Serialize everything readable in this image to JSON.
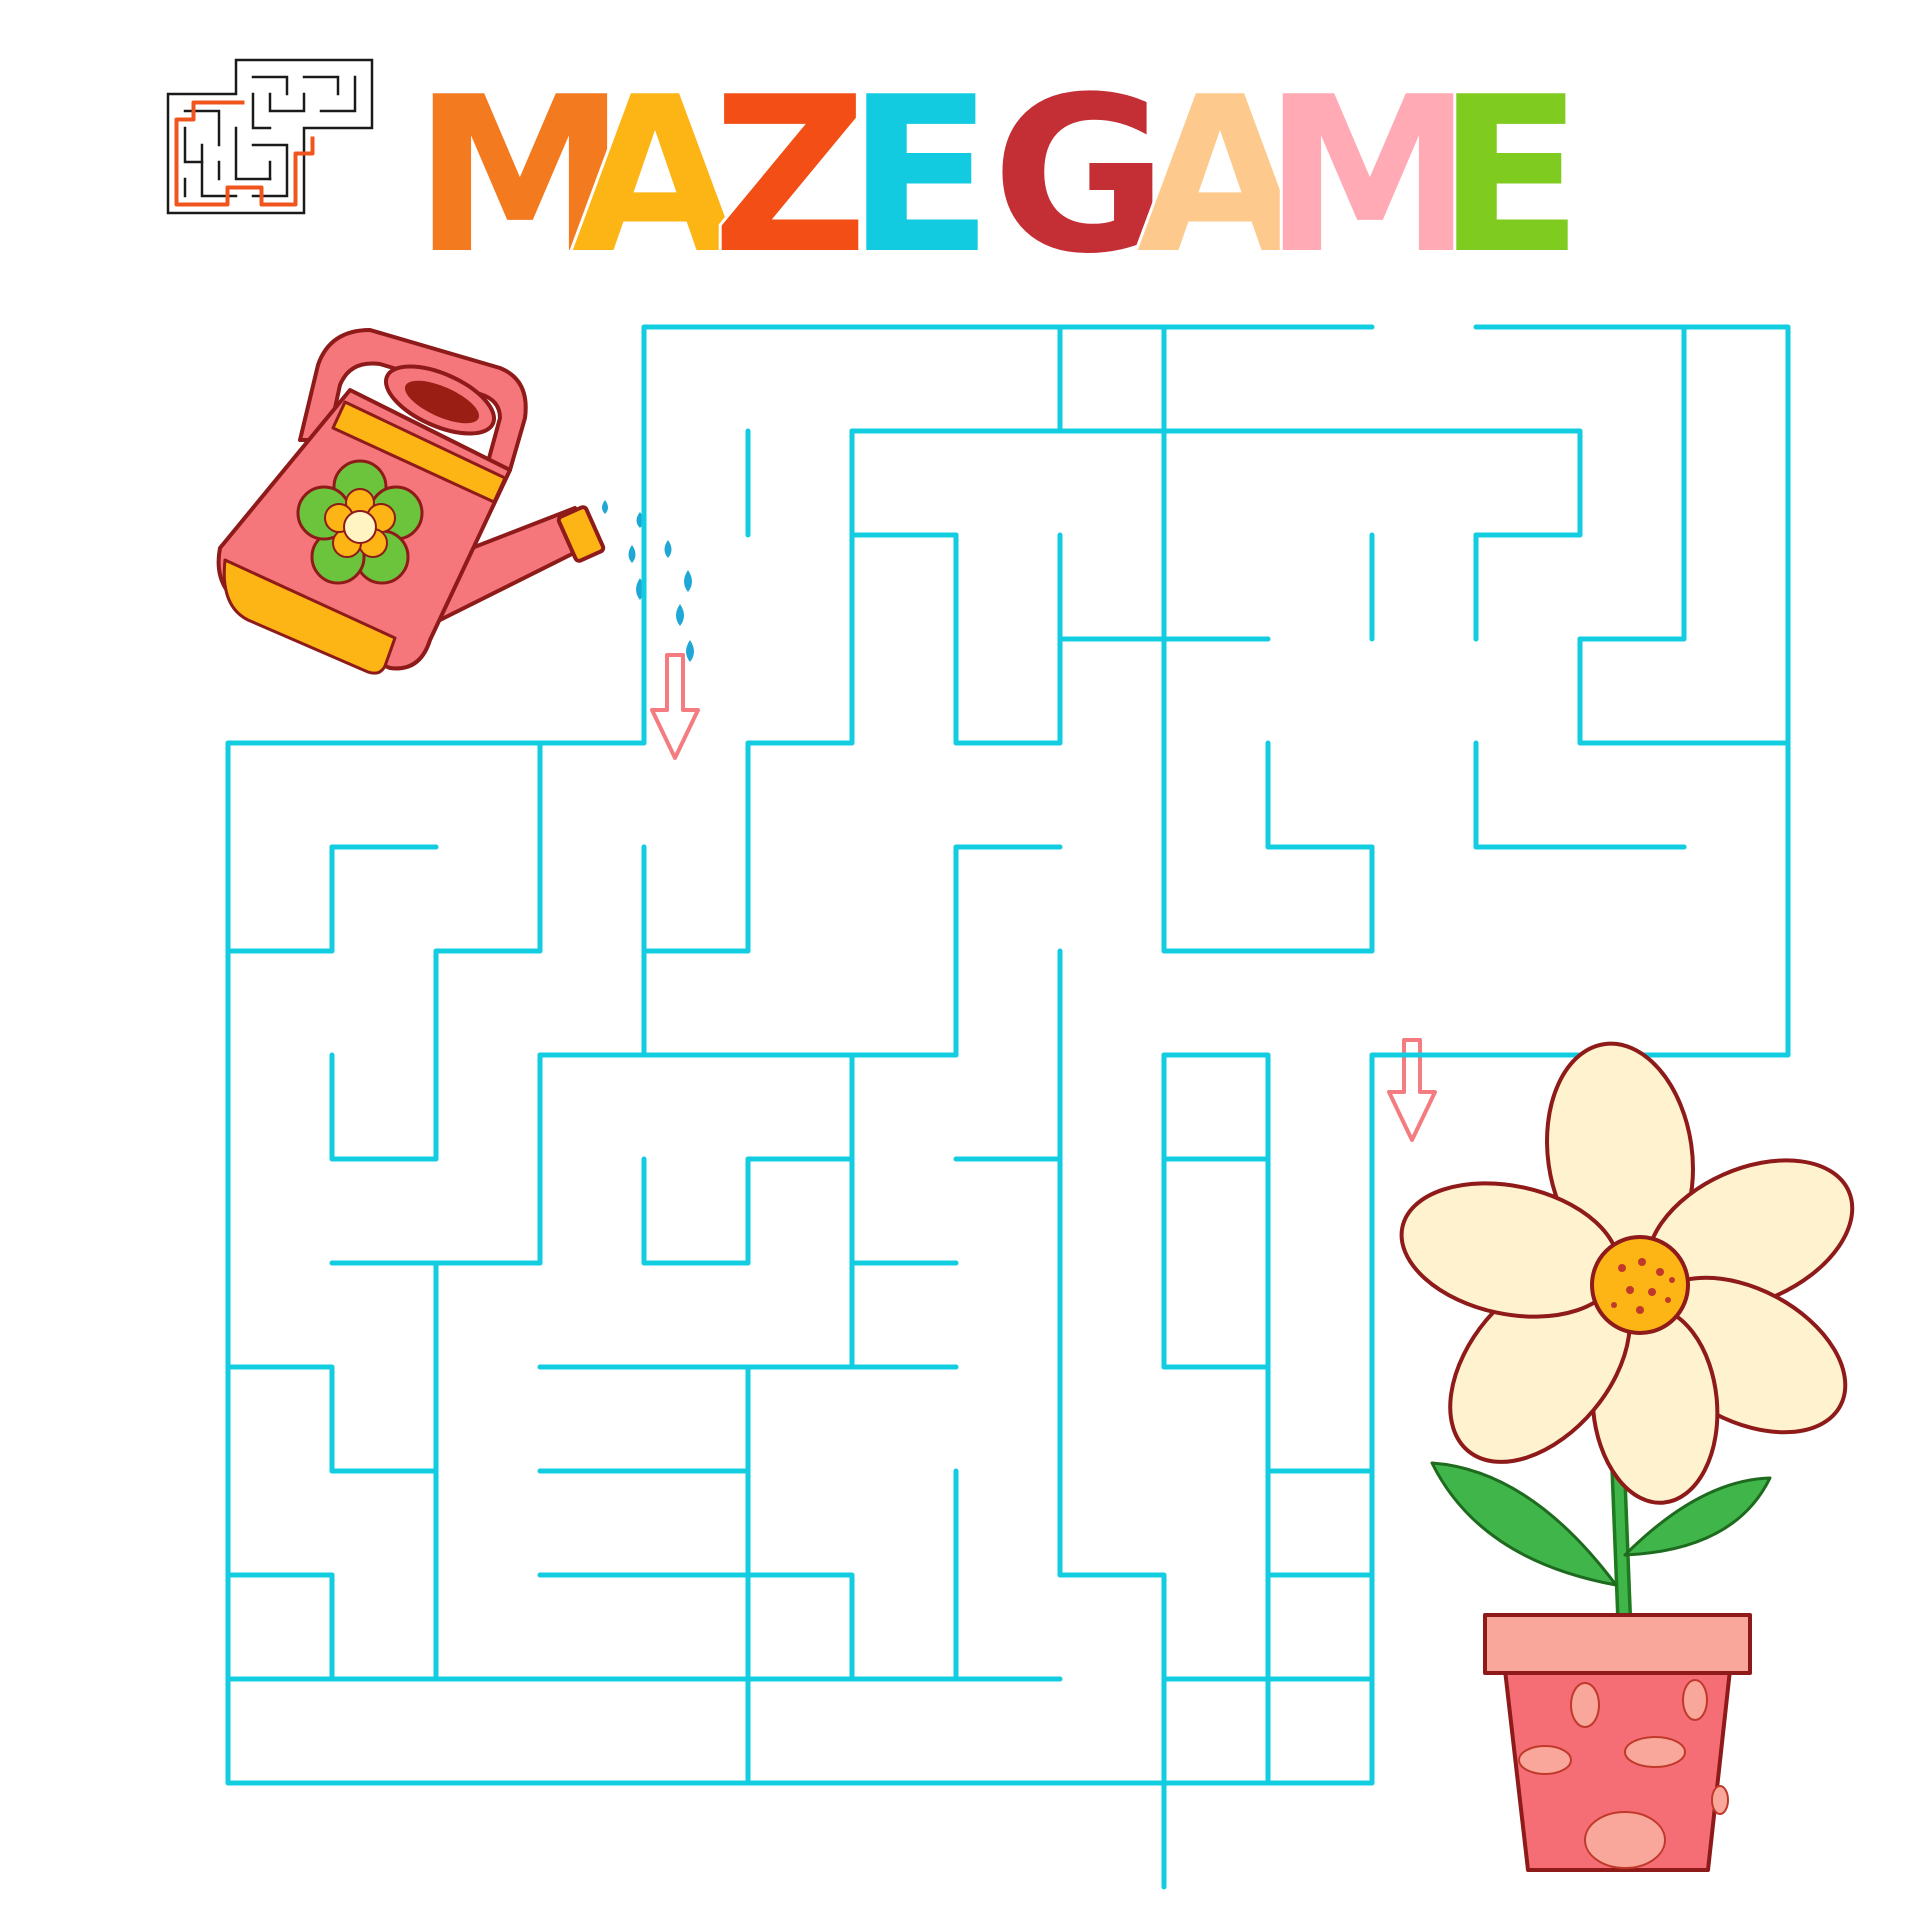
{
  "title": {
    "letters": [
      {
        "char": "M",
        "color": "#F47A20"
      },
      {
        "char": "A",
        "color": "#FDB515"
      },
      {
        "char": "Z",
        "color": "#F24E16"
      },
      {
        "char": "E",
        "color": "#12CBE0"
      },
      {
        "char": "G",
        "color": "#C42F36"
      },
      {
        "char": "A",
        "color": "#FDC98C"
      },
      {
        "char": "M",
        "color": "#FFAAB5"
      },
      {
        "char": "E",
        "color": "#7FCB1F"
      }
    ]
  },
  "colors": {
    "maze_wall": "#12CDE0",
    "arrow": "#F47C80",
    "thumbnail_wall": "#1a1a1a",
    "thumbnail_path": "#F0551E",
    "water": "#1FA7D6"
  },
  "icons": {
    "thumbnail": "maze-thumbnail-icon",
    "start": "watering-can-icon",
    "start_arrow": "arrow-down-icon",
    "finish": "potted-flower-icon",
    "finish_arrow": "arrow-down-icon"
  }
}
